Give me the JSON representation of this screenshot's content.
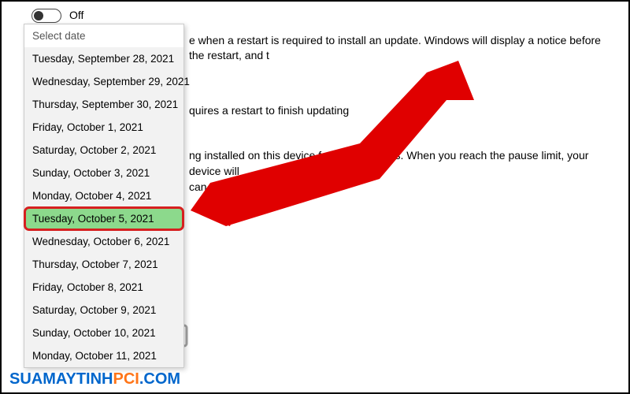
{
  "toggle": {
    "state_label": "Off"
  },
  "descriptions": {
    "line1": "e when a restart is required to install an update. Windows will display a notice before the restart, and t",
    "line2": "quires a restart to finish updating",
    "line3a": "ng installed on this device for up to 35 days. When you reach the pause limit, your device will",
    "line3b": "can pause again."
  },
  "dropdown": {
    "header": "Select date",
    "items": [
      {
        "label": "Tuesday, September 28, 2021",
        "highlight": false
      },
      {
        "label": "Wednesday, September 29, 2021",
        "highlight": false
      },
      {
        "label": "Thursday, September 30, 2021",
        "highlight": false
      },
      {
        "label": "Friday, October 1, 2021",
        "highlight": false
      },
      {
        "label": "Saturday, October 2, 2021",
        "highlight": false
      },
      {
        "label": "Sunday, October 3, 2021",
        "highlight": false
      },
      {
        "label": "Monday, October 4, 2021",
        "highlight": false
      },
      {
        "label": "Tuesday, October 5, 2021",
        "highlight": true
      },
      {
        "label": "Wednesday, October 6, 2021",
        "highlight": false
      },
      {
        "label": "Thursday, October 7, 2021",
        "highlight": false
      },
      {
        "label": "Friday, October 8, 2021",
        "highlight": false
      },
      {
        "label": "Saturday, October 9, 2021",
        "highlight": false
      },
      {
        "label": "Sunday, October 10, 2021",
        "highlight": false
      },
      {
        "label": "Monday, October 11, 2021",
        "highlight": false
      }
    ]
  },
  "watermark": {
    "part1": "SUAMAYTINH",
    "part2": "PCI",
    "part3": ".COM"
  },
  "colors": {
    "highlight_bg": "#8cd98c",
    "highlight_border": "#d62020",
    "arrow": "#e00000"
  }
}
